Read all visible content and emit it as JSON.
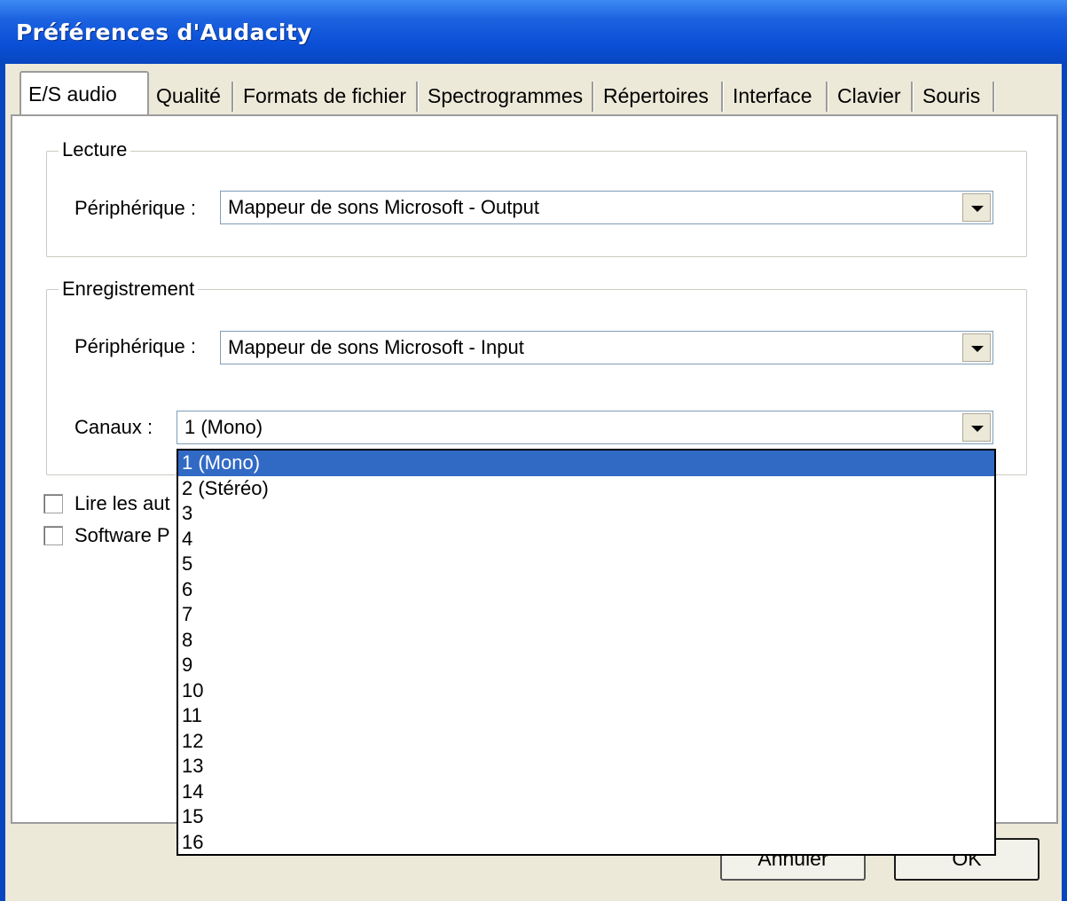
{
  "window": {
    "title": "Préférences d'Audacity"
  },
  "tabs": [
    {
      "label": "E/S audio",
      "active": true
    },
    {
      "label": "Qualité"
    },
    {
      "label": "Formats de fichier"
    },
    {
      "label": "Spectrogrammes"
    },
    {
      "label": "Répertoires"
    },
    {
      "label": "Interface"
    },
    {
      "label": "Clavier"
    },
    {
      "label": "Souris"
    }
  ],
  "playback": {
    "group_label": "Lecture",
    "device_label": "Périphérique :",
    "device_value": "Mappeur de sons Microsoft - Output"
  },
  "recording": {
    "group_label": "Enregistrement",
    "device_label": "Périphérique :",
    "device_value": "Mappeur de sons Microsoft - Input",
    "channels_label": "Canaux :",
    "channels_value": "1 (Mono)"
  },
  "checkboxes": [
    {
      "label": "Lire les aut",
      "checked": false
    },
    {
      "label": "Software P",
      "checked": false
    }
  ],
  "channels_dropdown": {
    "options": [
      "1 (Mono)",
      "2 (Stéréo)",
      "3",
      "4",
      "5",
      "6",
      "7",
      "8",
      "9",
      "10",
      "11",
      "12",
      "13",
      "14",
      "15",
      "16"
    ],
    "selected": "1 (Mono)"
  },
  "buttons": {
    "cancel": "Annuler",
    "ok": "OK"
  },
  "colors": {
    "titlebar": "#0a4fd6",
    "selection": "#316ac5",
    "dialog_bg": "#ece9d8"
  }
}
